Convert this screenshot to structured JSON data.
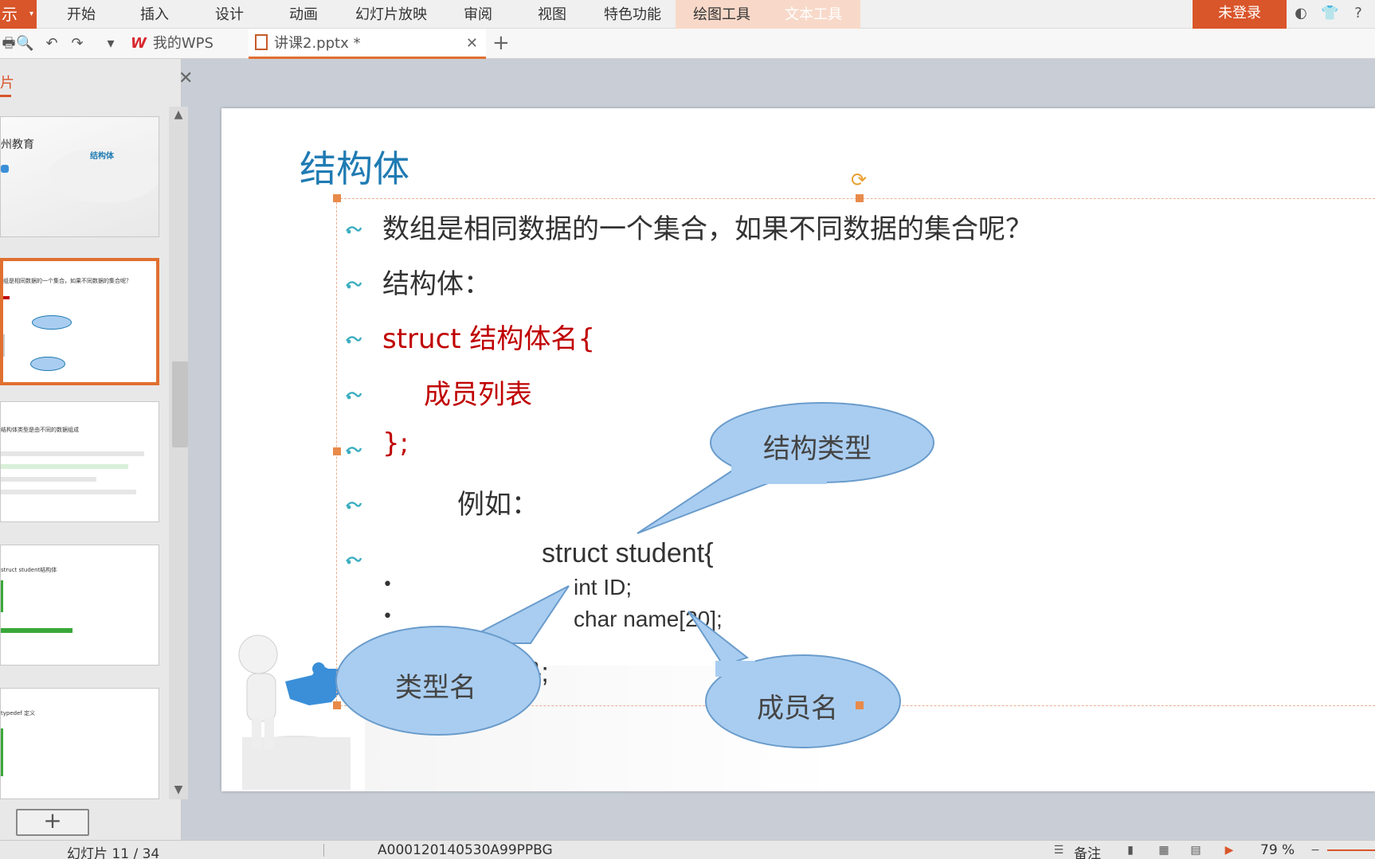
{
  "app": {
    "menu_button_label": "示",
    "login_label": "未登录"
  },
  "menu": {
    "items": [
      "开始",
      "插入",
      "设计",
      "动画",
      "幻灯片放映",
      "审阅",
      "视图",
      "特色功能",
      "绘图工具",
      "文本工具"
    ]
  },
  "tabs": {
    "wps_label": "我的WPS",
    "doc_label": "讲课2.pptx *"
  },
  "panel": {
    "title": "片",
    "thumbs": [
      {
        "title": "州教育",
        "sub": "结构体"
      },
      {
        "title": "组是相同数据的一个集合，如果不同数据的集合呢？"
      },
      {
        "title": "结构体类型是由不同的数据组成"
      },
      {
        "title": "struct student结构体"
      },
      {
        "title": "typedef 定义"
      }
    ]
  },
  "slide": {
    "title": "结构体",
    "lines": [
      {
        "text": "数组是相同数据的一个集合，如果不同数据的集合呢？",
        "color": "#333333"
      },
      {
        "text": "结构体：",
        "color": "#333333"
      },
      {
        "text": "struct 结构体名{",
        "color": "#c00000"
      },
      {
        "text": "成员列表",
        "color": "#c00000"
      },
      {
        "text": "};",
        "color": "#c00000"
      },
      {
        "text": "例如：",
        "color": "#333333"
      }
    ],
    "code": [
      "struct student{",
      "int ID;",
      "char name[20];",
      "};"
    ],
    "callouts": {
      "struct_type": "结构类型",
      "type_name": "类型名",
      "member_name": "成员名"
    },
    "callout_color": "#a9cdf0"
  },
  "status": {
    "slide_counter": "幻灯片 11 / 34",
    "doc_id": "A000120140530A99PPBG",
    "notes_label": "备注",
    "zoom": "79 %"
  },
  "colors": {
    "accent": "#d9552a",
    "title_blue": "#1f7bb3",
    "code_red": "#c00000"
  }
}
